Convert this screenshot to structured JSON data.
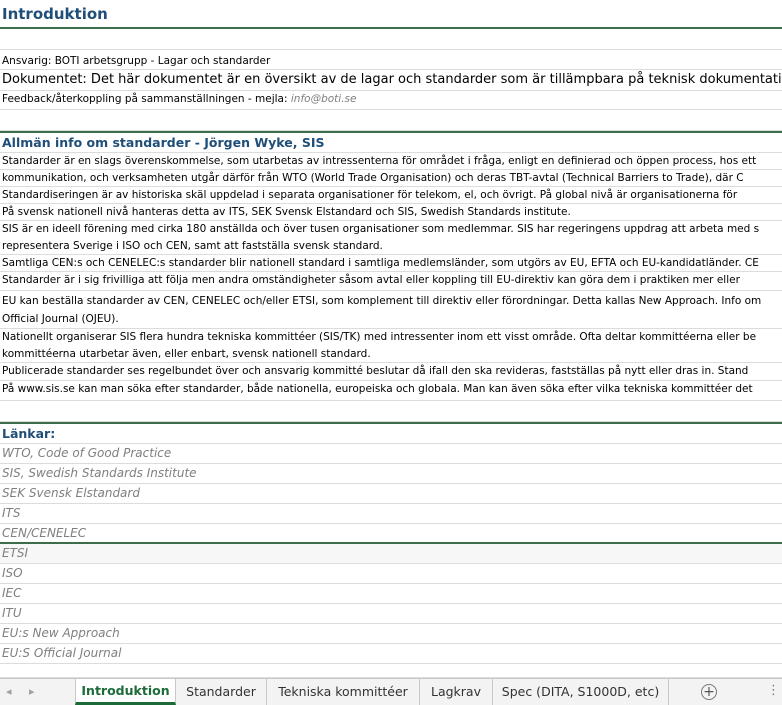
{
  "title": "Introduktion",
  "responsible": "Ansvarig: BOTI arbetsgrupp -  Lagar och standarder",
  "document": "Dokumentet: Det här dokumentet är en översikt av de lagar och standarder som är tillämpbara på teknisk dokumentation.",
  "feedback": {
    "label": "Feedback/återkoppling på sammanställningen -  mejla: ",
    "email": "info@boti.se"
  },
  "info_heading": "Allmän info om standarder - Jörgen Wyke, SIS",
  "info_rows": [
    "Standarder är en slags överenskommelse, som utarbetas av intressenterna för området i fråga, enligt en definierad och öppen process, hos ett",
    "kommunikation, och verksamheten utgår därför från WTO (World Trade Organisation) och deras TBT-avtal (Technical Barriers to Trade), där C",
    "Standardiseringen är av historiska skäl uppdelad i separata organisationer för telekom, el, och övrigt. På global nivå är organisationerna för",
    "På svensk nationell nivå hanteras detta av ITS, SEK Svensk Elstandard och SIS, Swedish Standards institute.",
    "SIS är en ideell förening med cirka 180 anställda och över tusen organisationer som medlemmar. SIS har regeringens uppdrag att arbeta med s",
    "representera Sverige i ISO och CEN, samt att fastställa svensk standard.",
    "Samtliga CEN:s och CENELEC:s standarder blir nationell standard i samtliga medlemsländer, som utgörs av EU, EFTA och EU-kandidatländer. CE",
    "Standarder är i sig frivilliga att följa men andra omständigheter såsom avtal eller koppling till EU-direktiv kan göra dem i praktiken mer eller",
    "EU kan beställa standarder av CEN, CENELEC och/eller ETSI, som komplement till direktiv eller förordningar. Detta kallas New Approach. Info om",
    "Official Journal (OJEU).",
    "Nationellt organiserar SIS flera hundra tekniska kommittéer (SIS/TK) med intressenter inom ett visst område. Ofta deltar kommittéerna eller be",
    "kommittéerna utarbetar även, eller enbart, svensk nationell standard.",
    "Publicerade standarder ses regelbundet över och ansvarig kommitté beslutar då ifall den ska revideras, fastställas på nytt eller dras in. Stand",
    "På www.sis.se kan man söka efter standarder, både nationella, europeiska och globala. Man kan även söka efter vilka tekniska kommittéer det"
  ],
  "links_heading": "Länkar:",
  "links": [
    "WTO, Code of Good Practice",
    "SIS, Swedish Standards Institute",
    "SEK Svensk Elstandard",
    "ITS",
    "CEN/CENELEC",
    "ETSI",
    "ISO",
    "IEC",
    "ITU",
    "EU:s New Approach",
    "EU:S Official Journal"
  ],
  "tabs": [
    "Introduktion",
    "Standarder",
    "Tekniska kommittéer",
    "Lagkrav",
    "Spec (DITA, S1000D, etc)"
  ],
  "tab_nav": {
    "prev": "◂",
    "next": "▸",
    "add": "+",
    "more": "⋮"
  },
  "colors": {
    "heading": "#1f4e79",
    "active_tab": "#1e6b3a",
    "link": "#7f7f7f"
  }
}
